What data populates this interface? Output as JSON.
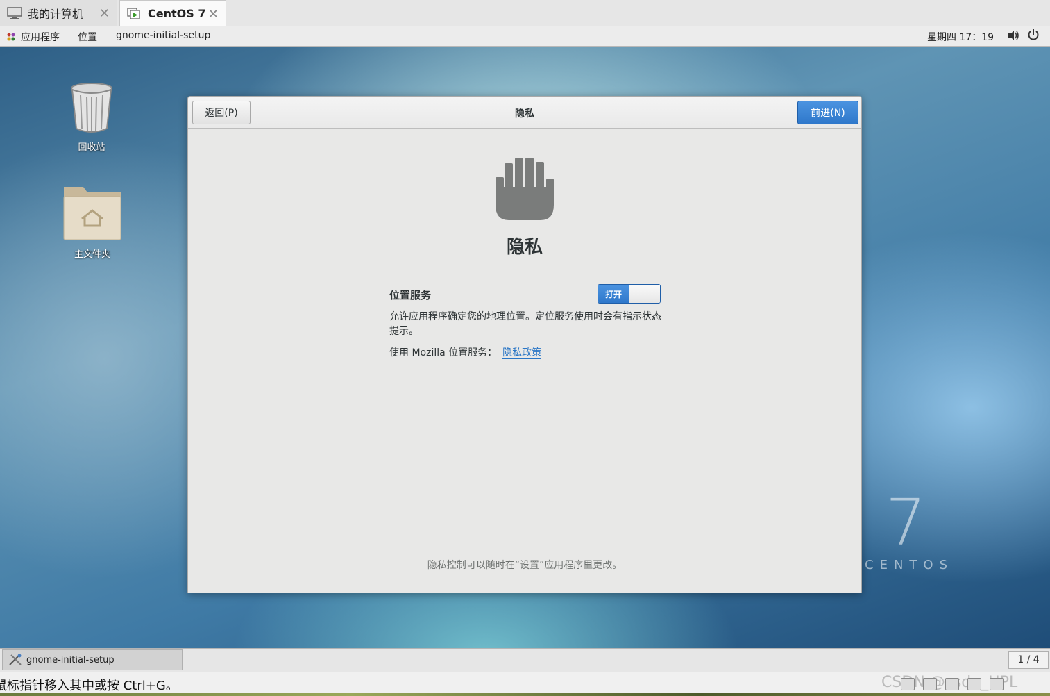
{
  "vm_tabs": [
    {
      "label": "我的计算机",
      "close": "✕"
    },
    {
      "label": "CentOS 7",
      "close": "✕"
    }
  ],
  "top_panel": {
    "applications": "应用程序",
    "places": "位置",
    "app_name": "gnome-initial-setup",
    "clock": "星期四 17：19",
    "volume_icon": "🔊",
    "power_icon": "⏻"
  },
  "desktop": {
    "trash_label": "回收站",
    "home_label": "主文件夹",
    "brand_number": "7",
    "brand_word": "CENTOS"
  },
  "dialog": {
    "back_label": "返回(P)",
    "title": "隐私",
    "next_label": "前进(N)",
    "heading": "隐私",
    "location_label": "位置服务",
    "switch_on_label": "打开",
    "location_enabled": true,
    "location_description": "允许应用程序确定您的地理位置。定位服务使用时会有指示状态提示。",
    "mozilla_text": "使用 Mozilla 位置服务：",
    "policy_link": "隐私政策",
    "footer_note": "隐私控制可以随时在“设置”应用程序里更改。"
  },
  "bottom_panel": {
    "task_label": "gnome-initial-setup",
    "workspace": "1 / 4"
  },
  "status_bar": {
    "message": "鼠标指针移入其中或按 Ctrl+G。",
    "watermark": "CSDN @csdn_HPL"
  },
  "colors": {
    "accent": "#3584e4",
    "link": "#2a76c6"
  }
}
